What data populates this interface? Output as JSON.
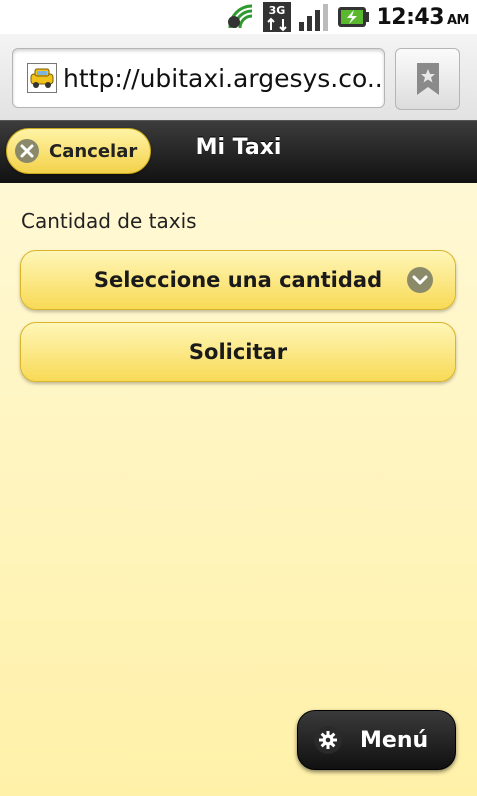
{
  "status_bar": {
    "time": "12:43",
    "ampm": "AM",
    "network_type": "3G",
    "icons": [
      "wifi-signal-icon",
      "3g-data-icon",
      "cell-signal-icon",
      "battery-charging-icon"
    ]
  },
  "browser": {
    "url": "http://ubitaxi.argesys.co...",
    "favicon": "taxi-favicon-icon",
    "bookmark_icon": "bookmark-icon"
  },
  "header": {
    "cancel_label": "Cancelar",
    "title": "Mi Taxi"
  },
  "form": {
    "label": "Cantidad de taxis",
    "select_value": "Seleccione una cantidad",
    "submit_label": "Solicitar"
  },
  "footer": {
    "menu_label": "Menú"
  },
  "colors": {
    "accent_yellow": "#f8da56",
    "background_yellow": "#fff8d4",
    "header_dark": "#111111"
  }
}
